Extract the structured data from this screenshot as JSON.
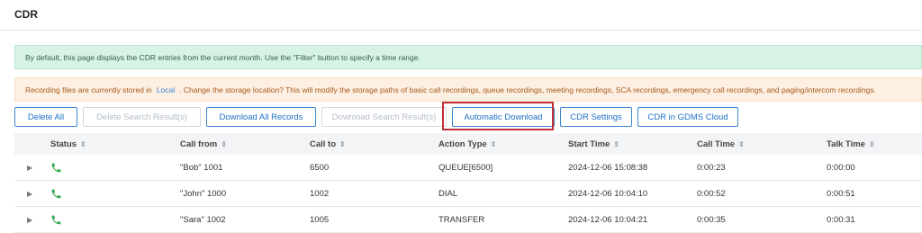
{
  "page": {
    "title": "CDR"
  },
  "notices": {
    "info": "By default, this page displays the CDR entries from the current month. Use the \"Filter\" button to specify a time range.",
    "storage_prefix": "Recording files are currently stored in",
    "storage_link": "Local",
    "storage_suffix": ". Change the storage location? This will modify the storage paths of basic call recordings, queue recordings, meeting recordings, SCA recordings, emergency call recordings, and paging/intercom recordings."
  },
  "toolbar": {
    "delete_all": "Delete All",
    "delete_search": "Delete Search Result(s)",
    "download_all": "Download All Records",
    "download_search": "Download Search Result(s)",
    "auto_download": "Automatic Download",
    "cdr_settings": "CDR Settings",
    "gdms_cloud": "CDR in GDMS Cloud"
  },
  "table": {
    "headers": {
      "status": "Status",
      "call_from": "Call from",
      "call_to": "Call to",
      "action_type": "Action Type",
      "start_time": "Start Time",
      "call_time": "Call Time",
      "talk_time": "Talk Time"
    },
    "rows": [
      {
        "call_from": "\"Bob\" 1001",
        "call_to": "6500",
        "action_type": "QUEUE[6500]",
        "start_time": "2024-12-06 15:08:38",
        "call_time": "0:00:23",
        "talk_time": "0:00:00"
      },
      {
        "call_from": "\"John\" 1000",
        "call_to": "1002",
        "action_type": "DIAL",
        "start_time": "2024-12-06 10:04:10",
        "call_time": "0:00:52",
        "talk_time": "0:00:51"
      },
      {
        "call_from": "\"Sara\" 1002",
        "call_to": "1005",
        "action_type": "TRANSFER",
        "start_time": "2024-12-06 10:04:21",
        "call_time": "0:00:35",
        "talk_time": "0:00:31"
      }
    ]
  },
  "icons": {
    "status": "phone-icon",
    "expand": "expand-caret-icon",
    "sort": "sort-arrows-icon"
  },
  "colors": {
    "accent": "#1d6fc3",
    "status_ok": "#2fa84f",
    "highlight": "#c12f38"
  }
}
